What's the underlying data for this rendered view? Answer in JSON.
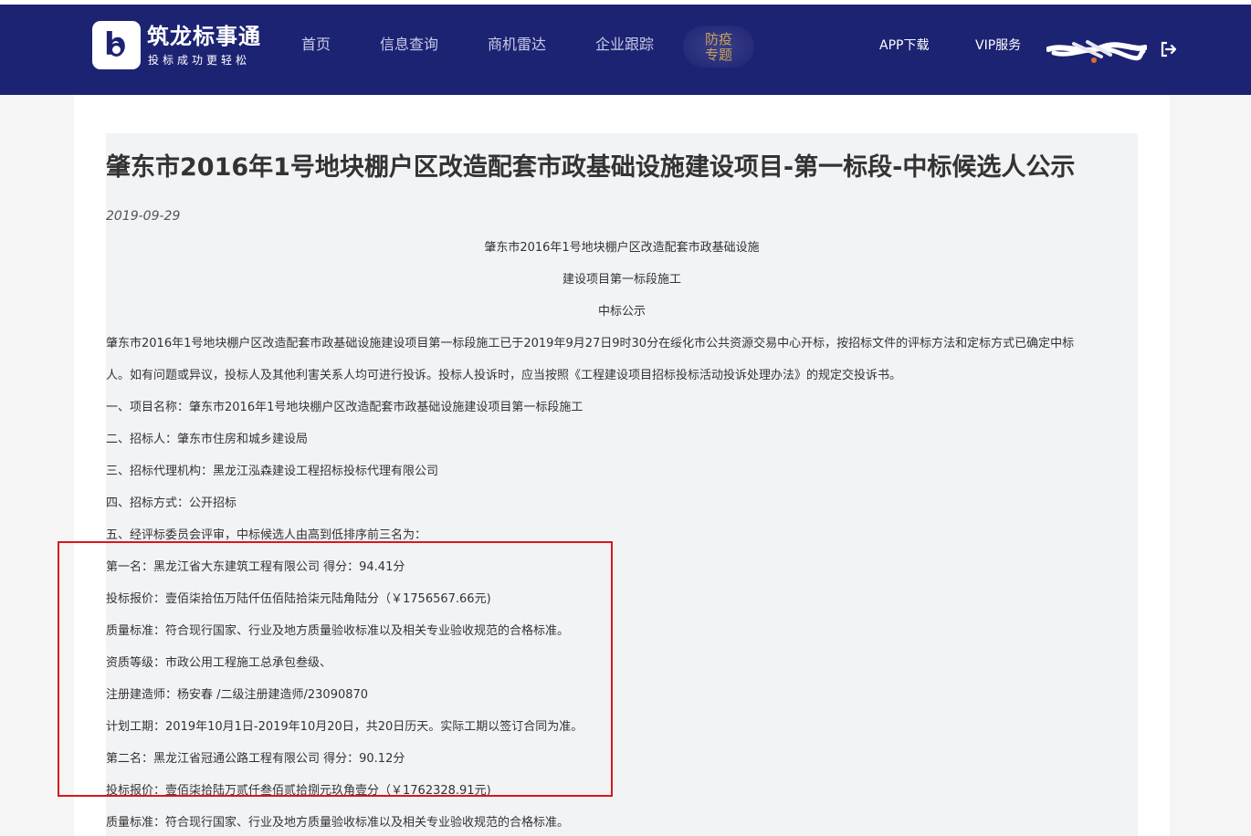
{
  "header": {
    "logo": {
      "name": "筑龙标事通",
      "slogan": "投标成功更轻松"
    },
    "nav": [
      {
        "label": "首页"
      },
      {
        "label": "信息查询"
      },
      {
        "label": "商机雷达"
      },
      {
        "label": "企业跟踪"
      }
    ],
    "special": {
      "line1": "防疫",
      "line2": "专题"
    },
    "right": {
      "app_download": "APP下载",
      "vip_service": "VIP服务"
    }
  },
  "article": {
    "title": "肇东市2016年1号地块棚户区改造配套市政基础设施建设项目-第一标段-中标候选人公示",
    "date": "2019-09-29",
    "heading_lines": [
      "肇东市2016年1号地块棚户区改造配套市政基础设施",
      "建设项目第一标段施工",
      "中标公示"
    ],
    "body_lines": [
      "肇东市2016年1号地块棚户区改造配套市政基础设施建设项目第一标段施工已于2019年9月27日9时30分在绥化市公共资源交易中心开标，按招标文件的评标方法和定标方式已确定中标",
      "人。如有问题或异议，投标人及其他利害关系人均可进行投诉。投标人投诉时，应当按照《工程建设项目招标投标活动投诉处理办法》的规定交投诉书。",
      "一、项目名称：肇东市2016年1号地块棚户区改造配套市政基础设施建设项目第一标段施工",
      "二、招标人：肇东市住房和城乡建设局",
      "三、招标代理机构：黑龙江泓森建设工程招标投标代理有限公司",
      "四、招标方式：公开招标",
      "五、经评标委员会评审，中标候选人由高到低排序前三名为：",
      "第一名：黑龙江省大东建筑工程有限公司 得分：94.41分",
      "投标报价：壹佰柒拾伍万陆仟伍佰陆拾柒元陆角陆分（￥1756567.66元)",
      "质量标准：符合现行国家、行业及地方质量验收标准以及相关专业验收规范的合格标准。",
      "资质等级：市政公用工程施工总承包叁级、",
      "注册建造师：杨安春 /二级注册建造师/23090870",
      "计划工期：2019年10月1日-2019年10月20日，共20日历天。实际工期以签订合同为准。",
      "第二名：黑龙江省冠通公路工程有限公司 得分：90.12分",
      "投标报价：壹佰柒拾陆万贰仟叁佰贰拾捌元玖角壹分（￥1762328.91元)",
      "质量标准：符合现行国家、行业及地方质量验收标准以及相关专业验收规范的合格标准。"
    ]
  },
  "colors": {
    "header_bg": "#1d2373",
    "nav_text": "#c8cbe6",
    "special_text": "#c9a25a",
    "highlight_border": "#d9161c"
  },
  "icons": {
    "logout": "logout-icon",
    "logo": "logo-icon"
  }
}
